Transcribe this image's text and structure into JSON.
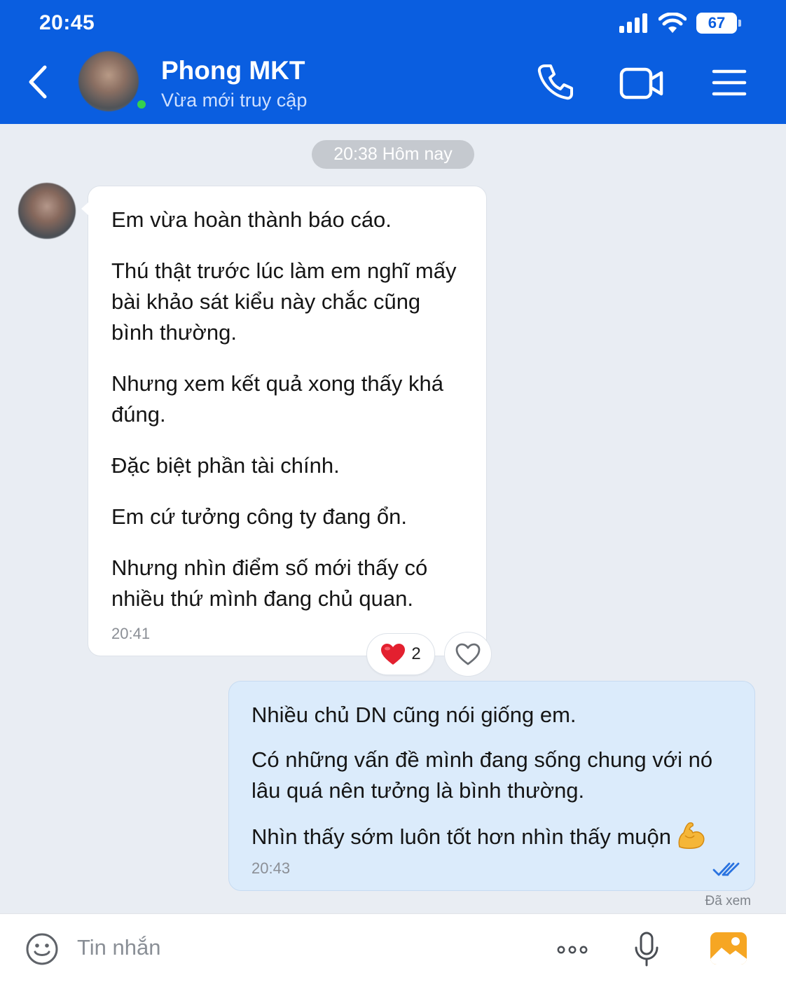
{
  "status_bar": {
    "time": "20:45",
    "battery": "67",
    "icons": [
      "signal-icon",
      "wifi-icon",
      "battery-icon"
    ]
  },
  "header": {
    "contact_name": "Phong MKT",
    "contact_status": "Vừa mới truy cập",
    "buttons": [
      "back-icon",
      "phone-icon",
      "video-icon",
      "menu-icon"
    ],
    "color": "#0a5ee0"
  },
  "chat": {
    "date_separator": "20:38 Hôm nay",
    "incoming": {
      "paragraphs": [
        "Em vừa hoàn thành báo cáo.",
        "Thú thật trước lúc làm em nghĩ mấy bài khảo sát kiểu này chắc cũng bình thường.",
        "Nhưng xem kết quả xong thấy khá đúng.",
        "Đặc biệt phần tài chính.",
        "Em cứ tưởng công ty đang ổn.",
        "Nhưng nhìn điểm số mới thấy có nhiều thứ mình đang chủ quan."
      ],
      "time": "20:41",
      "reaction_count": "2",
      "reaction_icon": "heart-icon"
    },
    "outgoing": {
      "paragraphs": [
        "Nhiều chủ DN cũng nói giống em.",
        "Có những vấn đề mình đang sống chung với nó lâu quá nên tưởng là bình thường.",
        "Nhìn thấy sớm luôn tốt hơn nhìn thấy muộn"
      ],
      "emoji": "flexed-biceps-icon",
      "time": "20:43",
      "seen_label": "Đã xem"
    }
  },
  "input_bar": {
    "placeholder": "Tin nhắn",
    "icons": [
      "emoji-icon",
      "more-icon",
      "microphone-icon",
      "image-icon"
    ]
  }
}
